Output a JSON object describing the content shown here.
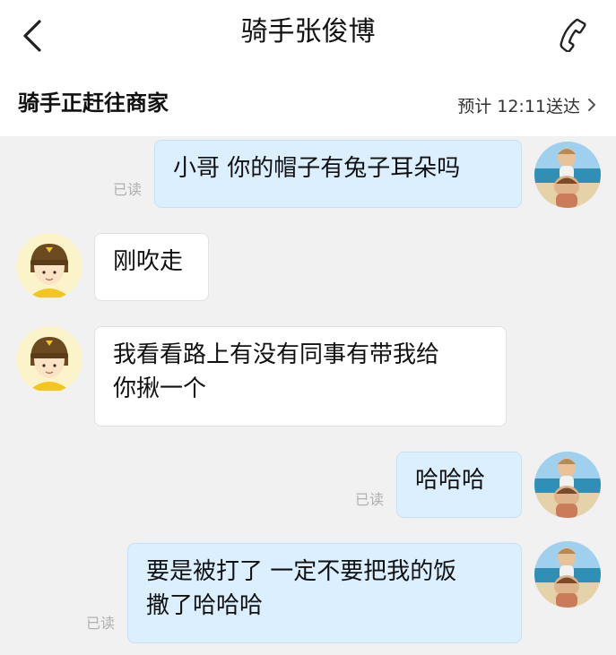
{
  "header": {
    "title": "骑手张俊博"
  },
  "status_bar": {
    "text": "骑手正赶往商家",
    "eta": "预计 12:11送达"
  },
  "messages": [
    {
      "sender": "me",
      "text": "小哥 你的帽子有兔子耳朵吗",
      "read_label": "已读"
    },
    {
      "sender": "rider",
      "text": "刚吹走"
    },
    {
      "sender": "rider",
      "text": "我看看路上有没有同事有带我给\n你揪一个"
    },
    {
      "sender": "me",
      "text": "哈哈哈",
      "read_label": "已读"
    },
    {
      "sender": "me",
      "text": "要是被打了 一定不要把我的饭\n撒了哈哈哈",
      "read_label": "已读"
    }
  ],
  "icons": {
    "back": "chevron-left-icon",
    "phone": "phone-icon",
    "eta_arrow": "chevron-right-icon"
  },
  "colors": {
    "background": "#f1f1f1",
    "header_bg": "#ffffff",
    "outgoing_bubble": "#dcefff",
    "incoming_bubble": "#ffffff",
    "read_text": "#b0b0b0",
    "rider_avatar_bg": "#f7d94a"
  }
}
